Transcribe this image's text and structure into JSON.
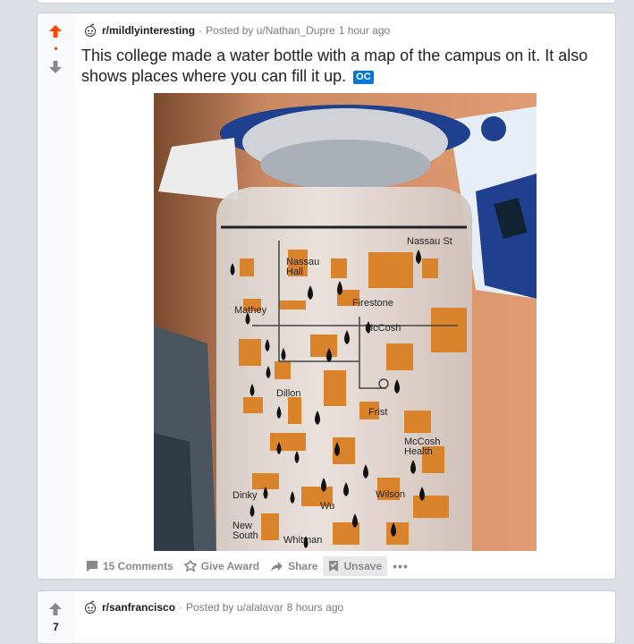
{
  "post1": {
    "subreddit": "r/mildlyinteresting",
    "posted_by": "Posted by u/Nathan_Dupre",
    "time": "1 hour ago",
    "title": "This college made a water bottle with a map of the campus on it. It also shows places where you can fill it up.",
    "flair": "OC",
    "score": "•",
    "image_labels": {
      "nassau_st": "Nassau St",
      "nassau_hall": "Nassau\nHall",
      "firestone": "Firestone",
      "mathey": "Mathey",
      "mccosh": "McCosh",
      "dillon": "Dillon",
      "frist": "Frist",
      "mccosh_health": "McCosh\nHealth",
      "dinky": "Dinky",
      "wilson": "Wilson",
      "new_south": "New\nSouth",
      "whitman": "Whitman",
      "wu": "Wu"
    },
    "actions": {
      "comments": "15 Comments",
      "award": "Give Award",
      "share": "Share",
      "unsave": "Unsave",
      "more": "•••"
    }
  },
  "post2": {
    "subreddit": "r/sanfrancisco",
    "posted_by": "Posted by u/alalavar",
    "time": "8 hours ago",
    "score": "7"
  },
  "colors": {
    "upvote_active": "#ff4500",
    "downvote": "#878a8c",
    "background": "#dae0e6",
    "oc_flair": "#0079d3"
  },
  "icons": {
    "upvote": "upvote-arrow-icon",
    "downvote": "downvote-arrow-icon",
    "subreddit": "snoo-icon",
    "comment": "comment-icon",
    "award": "award-icon",
    "share": "share-arrow-icon",
    "unsave": "bookmark-icon"
  }
}
